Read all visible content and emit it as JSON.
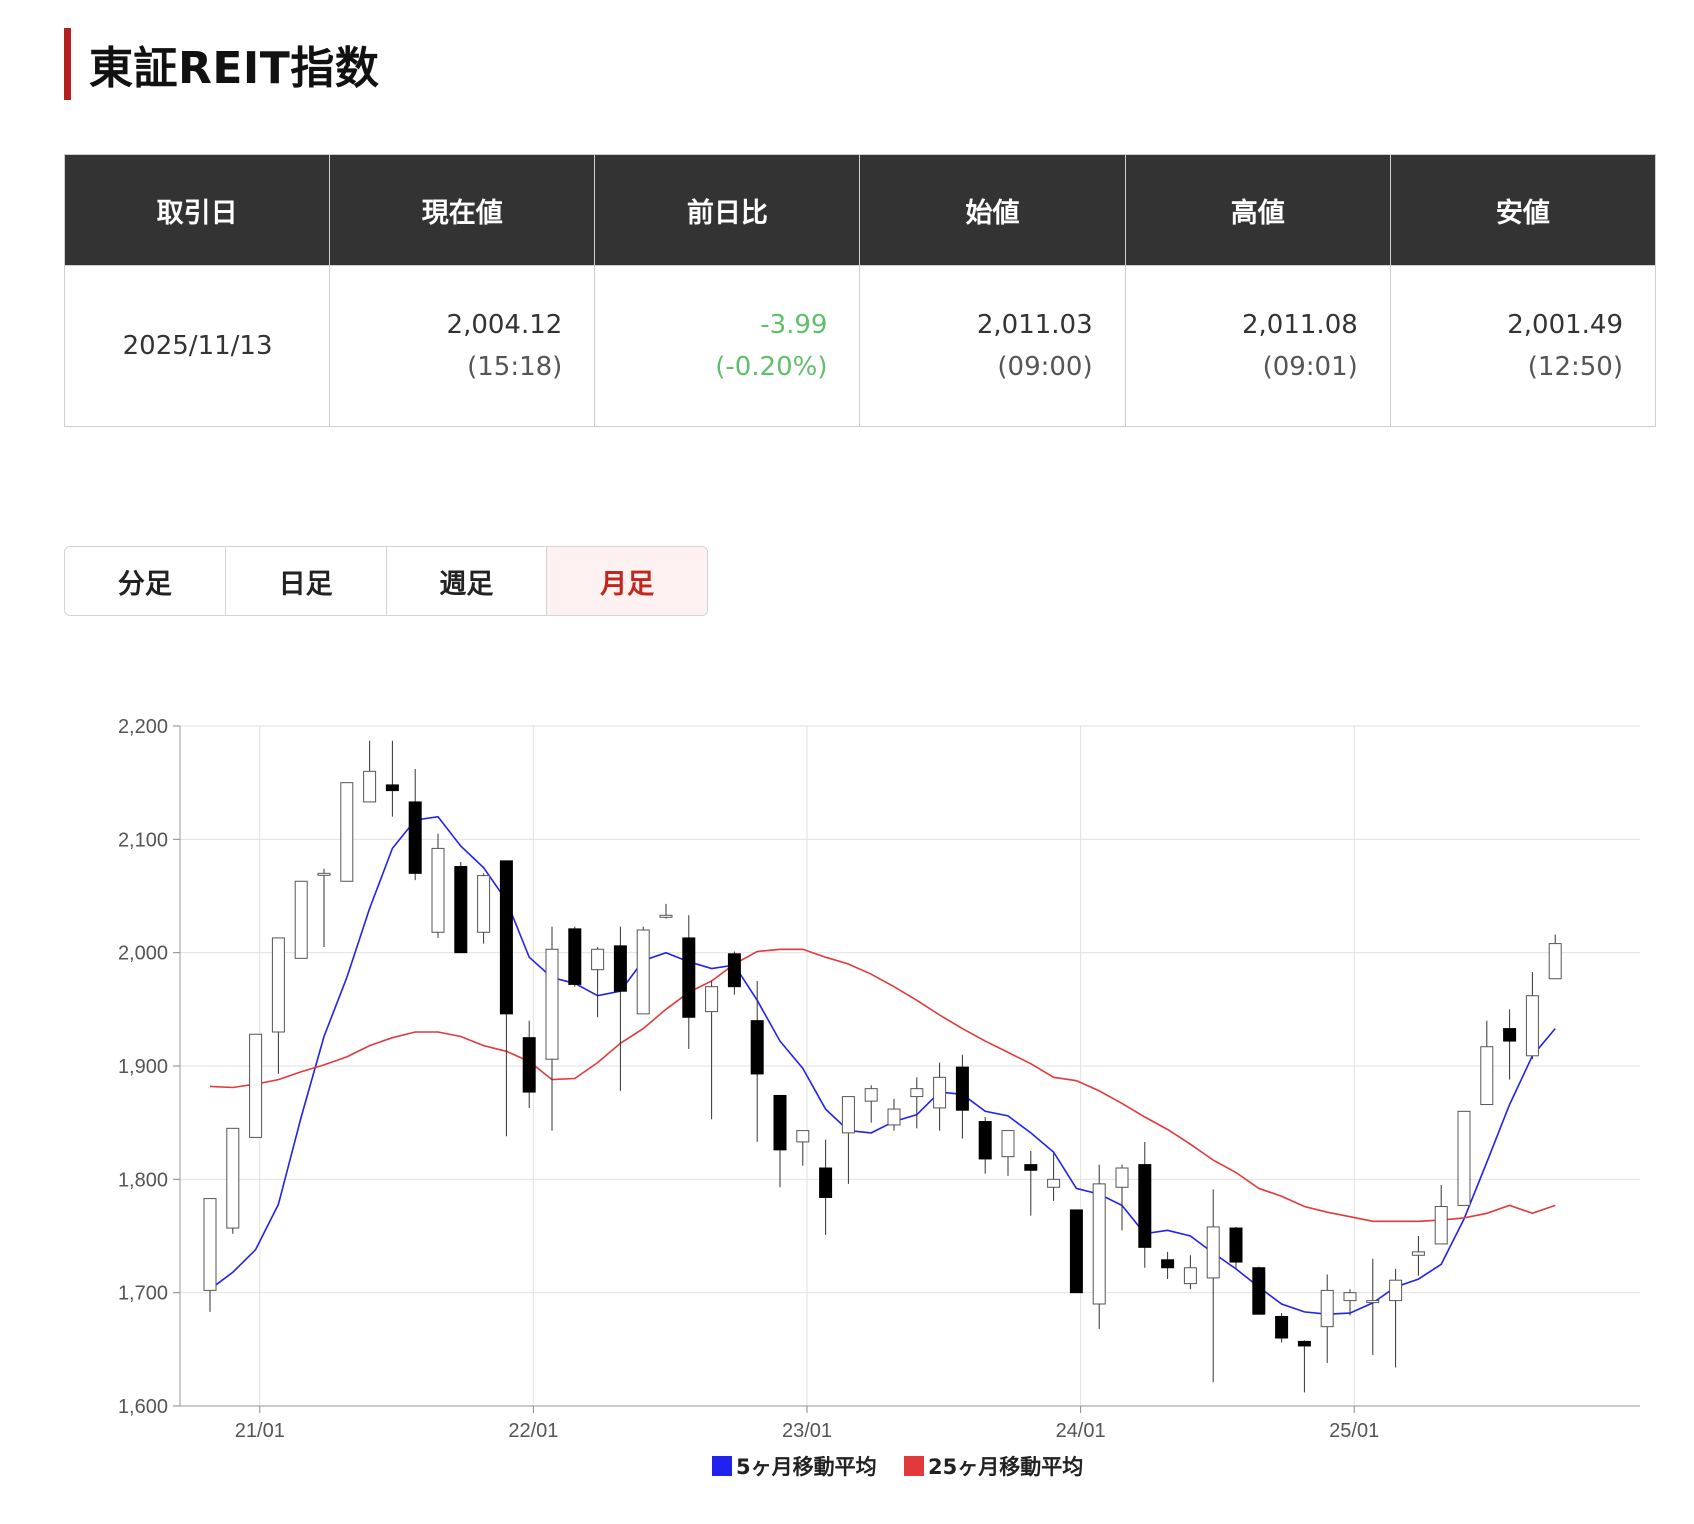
{
  "page_title": "東証REIT指数",
  "quote_table": {
    "headers": [
      "取引日",
      "現在値",
      "前日比",
      "始値",
      "高値",
      "安値"
    ],
    "date": "2025/11/13",
    "current": {
      "value": "2,004.12",
      "time": "(15:18)"
    },
    "change": {
      "value": "-3.99",
      "pct": "(-0.20%)"
    },
    "open": {
      "value": "2,011.03",
      "time": "(09:00)"
    },
    "high": {
      "value": "2,011.08",
      "time": "(09:01)"
    },
    "low": {
      "value": "2,001.49",
      "time": "(12:50)"
    }
  },
  "tabs": [
    {
      "label": "分足",
      "active": false
    },
    {
      "label": "日足",
      "active": false
    },
    {
      "label": "週足",
      "active": false
    },
    {
      "label": "月足",
      "active": true
    }
  ],
  "colors": {
    "accent": "#b3211f",
    "header_bg": "#333333",
    "down_text": "#5fbf6a",
    "ma5": "#2222ee",
    "ma25": "#e23a3a"
  },
  "chart_data": {
    "type": "candlestick",
    "ylim": [
      1600,
      2200
    ],
    "yticks": [
      "1,600",
      "1,700",
      "1,800",
      "1,900",
      "2,000",
      "2,100",
      "2,200"
    ],
    "xticks": [
      {
        "label": "21/01",
        "month": 1
      },
      {
        "label": "22/01",
        "month": 13
      },
      {
        "label": "23/01",
        "month": 25
      },
      {
        "label": "24/01",
        "month": 37
      },
      {
        "label": "25/01",
        "month": 49
      }
    ],
    "grid": true,
    "legend_position": "bottom",
    "months": [
      "20/12",
      "21/01",
      "21/02",
      "21/03",
      "21/04",
      "21/05",
      "21/06",
      "21/07",
      "21/08",
      "21/09",
      "21/10",
      "21/11",
      "21/12",
      "22/01",
      "22/02",
      "22/03",
      "22/04",
      "22/05",
      "22/06",
      "22/07",
      "22/08",
      "22/09",
      "22/10",
      "22/11",
      "22/12",
      "23/01",
      "23/02",
      "23/03",
      "23/04",
      "23/05",
      "23/06",
      "23/07",
      "23/08",
      "23/09",
      "23/10",
      "23/11",
      "23/12",
      "24/01",
      "24/02",
      "24/03",
      "24/04",
      "24/05",
      "24/06",
      "24/07",
      "24/08",
      "24/09",
      "24/10",
      "24/11",
      "24/12",
      "25/01",
      "25/02",
      "25/03",
      "25/04",
      "25/05",
      "25/06",
      "25/07",
      "25/08",
      "25/09",
      "25/10",
      "25/11"
    ],
    "ohlc": [
      [
        1702,
        1783,
        1683,
        1783
      ],
      [
        1757,
        1845,
        1752,
        1845
      ],
      [
        1837,
        1928,
        1837,
        1928
      ],
      [
        1930,
        2013,
        1893,
        2013
      ],
      [
        1995,
        2063,
        1995,
        2063
      ],
      [
        2070,
        2074,
        2005,
        2070
      ],
      [
        2063,
        2150,
        2063,
        2150
      ],
      [
        2133,
        2187,
        2133,
        2160
      ],
      [
        2148,
        2187,
        2120,
        2143
      ],
      [
        2133,
        2162,
        2064,
        2070
      ],
      [
        2018,
        2105,
        2013,
        2092
      ],
      [
        2076,
        2080,
        2000,
        2000
      ],
      [
        2018,
        2070,
        2008,
        2068
      ],
      [
        2081,
        2081,
        1838,
        1946
      ],
      [
        1925,
        1940,
        1863,
        1877
      ],
      [
        1906,
        2023,
        1843,
        2003
      ],
      [
        2021,
        2023,
        1970,
        1972
      ],
      [
        1985,
        2005,
        1943,
        2003
      ],
      [
        2006,
        2023,
        1878,
        1966
      ],
      [
        1946,
        2023,
        1946,
        2020
      ],
      [
        2033,
        2043,
        2030,
        2033
      ],
      [
        2013,
        2033,
        1915,
        1943
      ],
      [
        1948,
        1975,
        1853,
        1970
      ],
      [
        1999,
        2001,
        1963,
        1970
      ],
      [
        1940,
        1975,
        1833,
        1893
      ],
      [
        1874,
        1873,
        1793,
        1826
      ],
      [
        1833,
        1843,
        1812,
        1843
      ],
      [
        1810,
        1835,
        1751,
        1784
      ],
      [
        1841,
        1873,
        1796,
        1873
      ],
      [
        1869,
        1883,
        1850,
        1880
      ],
      [
        1848,
        1871,
        1843,
        1862
      ],
      [
        1873,
        1890,
        1845,
        1880
      ],
      [
        1863,
        1903,
        1843,
        1890
      ],
      [
        1899,
        1910,
        1836,
        1861
      ],
      [
        1851,
        1855,
        1805,
        1818
      ],
      [
        1820,
        1843,
        1803,
        1843
      ],
      [
        1813,
        1825,
        1768,
        1808
      ],
      [
        1793,
        1823,
        1781,
        1800
      ],
      [
        1773,
        1773,
        1700,
        1700
      ],
      [
        1690,
        1813,
        1668,
        1796
      ],
      [
        1793,
        1813,
        1755,
        1810
      ],
      [
        1813,
        1833,
        1722,
        1740
      ],
      [
        1729,
        1736,
        1712,
        1722
      ],
      [
        1708,
        1733,
        1703,
        1722
      ],
      [
        1713,
        1791,
        1621,
        1758
      ],
      [
        1757,
        1758,
        1722,
        1727
      ],
      [
        1722,
        1723,
        1682,
        1681
      ],
      [
        1679,
        1682,
        1656,
        1660
      ],
      [
        1657,
        1658,
        1612,
        1653
      ],
      [
        1670,
        1716,
        1638,
        1702
      ],
      [
        1693,
        1703,
        1680,
        1700
      ],
      [
        1693,
        1730,
        1645,
        1693
      ],
      [
        1693,
        1721,
        1634,
        1711
      ],
      [
        1733,
        1750,
        1715,
        1736
      ],
      [
        1743,
        1795,
        1743,
        1776
      ],
      [
        1777,
        1860,
        1777,
        1860
      ],
      [
        1866,
        1940,
        1866,
        1917
      ],
      [
        1933,
        1950,
        1888,
        1922
      ],
      [
        1909,
        1983,
        1906,
        1962
      ],
      [
        1977,
        2016,
        1977,
        2008
      ]
    ],
    "series": [
      {
        "name": "5ヶ月移動平均",
        "color": "#2222ee",
        "values": [
          1703,
          1718,
          1738,
          1778,
          1855,
          1926,
          1978,
          2039,
          2092,
          2117,
          2120,
          2094,
          2075,
          2046,
          1996,
          1978,
          1973,
          1962,
          1966,
          1993,
          2000,
          1992,
          1986,
          1989,
          1958,
          1922,
          1898,
          1862,
          1843,
          1841,
          1851,
          1857,
          1877,
          1875,
          1860,
          1856,
          1841,
          1824,
          1792,
          1787,
          1777,
          1752,
          1755,
          1750,
          1735,
          1721,
          1705,
          1690,
          1683,
          1681,
          1682,
          1691,
          1705,
          1712,
          1725,
          1765,
          1815,
          1866,
          1909,
          1933
        ]
      },
      {
        "name": "25ヶ月移動平均",
        "color": "#e23a3a",
        "values": [
          1882,
          1881,
          1884,
          1888,
          1895,
          1901,
          1908,
          1918,
          1925,
          1930,
          1930,
          1926,
          1918,
          1913,
          1904,
          1888,
          1889,
          1903,
          1920,
          1933,
          1950,
          1965,
          1975,
          1990,
          2001,
          2003,
          2003,
          1996,
          1990,
          1981,
          1970,
          1958,
          1945,
          1933,
          1922,
          1912,
          1902,
          1890,
          1887,
          1878,
          1867,
          1855,
          1844,
          1831,
          1817,
          1806,
          1792,
          1785,
          1776,
          1771,
          1767,
          1763,
          1763,
          1763,
          1764,
          1766,
          1770,
          1777,
          1770,
          1777
        ]
      }
    ],
    "legend": [
      "5ヶ月移動平均",
      "25ヶ月移動平均"
    ]
  }
}
